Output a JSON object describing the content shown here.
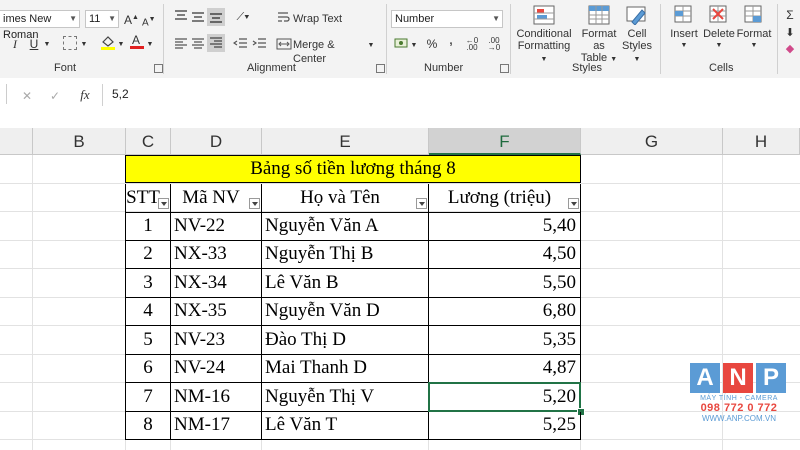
{
  "ribbon": {
    "font_name": "imes New Roman",
    "font_size": "11",
    "groups": {
      "font": "Font",
      "alignment": "Alignment",
      "number": "Number",
      "styles": "Styles",
      "cells": "Cells"
    },
    "wrap_text": "Wrap Text",
    "merge_center": "Merge & Center",
    "number_format": "Number",
    "conditional_formatting": [
      "Conditional",
      "Formatting"
    ],
    "format_as_table": [
      "Format as",
      "Table"
    ],
    "cell_styles": [
      "Cell",
      "Styles"
    ],
    "insert": "Insert",
    "delete": "Delete",
    "format": "Format"
  },
  "formula_bar": {
    "fx": "fx",
    "value": "5,2"
  },
  "columns": [
    "B",
    "C",
    "D",
    "E",
    "F",
    "G",
    "H"
  ],
  "selected_column": "F",
  "table": {
    "title": "Bảng số tiền lương tháng 8",
    "headers": [
      "STT",
      "Mã NV",
      "Họ và Tên",
      "Lương (triệu)"
    ],
    "rows": [
      [
        "1",
        "NV-22",
        "Nguyễn Văn A",
        "5,40"
      ],
      [
        "2",
        "NX-33",
        "Nguyễn Thị B",
        "4,50"
      ],
      [
        "3",
        "NX-34",
        "Lê Văn B",
        "5,50"
      ],
      [
        "4",
        "NX-35",
        "Nguyễn Văn D",
        "6,80"
      ],
      [
        "5",
        "NV-23",
        "Đào Thị D",
        "5,35"
      ],
      [
        "6",
        "NV-24",
        "Mai Thanh D",
        "4,87"
      ],
      [
        "7",
        "NM-16",
        "Nguyễn Thị V",
        "5,20"
      ],
      [
        "8",
        "NM-17",
        "Lê Văn T",
        "5,25"
      ]
    ]
  },
  "watermark": {
    "brand": "ANP",
    "tagline": "MÁY TÍNH - CAMERA",
    "phone": "098 772 0 772",
    "site": "WWW.ANP.COM.VN"
  },
  "colors": {
    "title_fill": "#ffff00",
    "selection_green": "#217346",
    "brand_blue": "#5b9bd5",
    "brand_red": "#e8473f"
  }
}
